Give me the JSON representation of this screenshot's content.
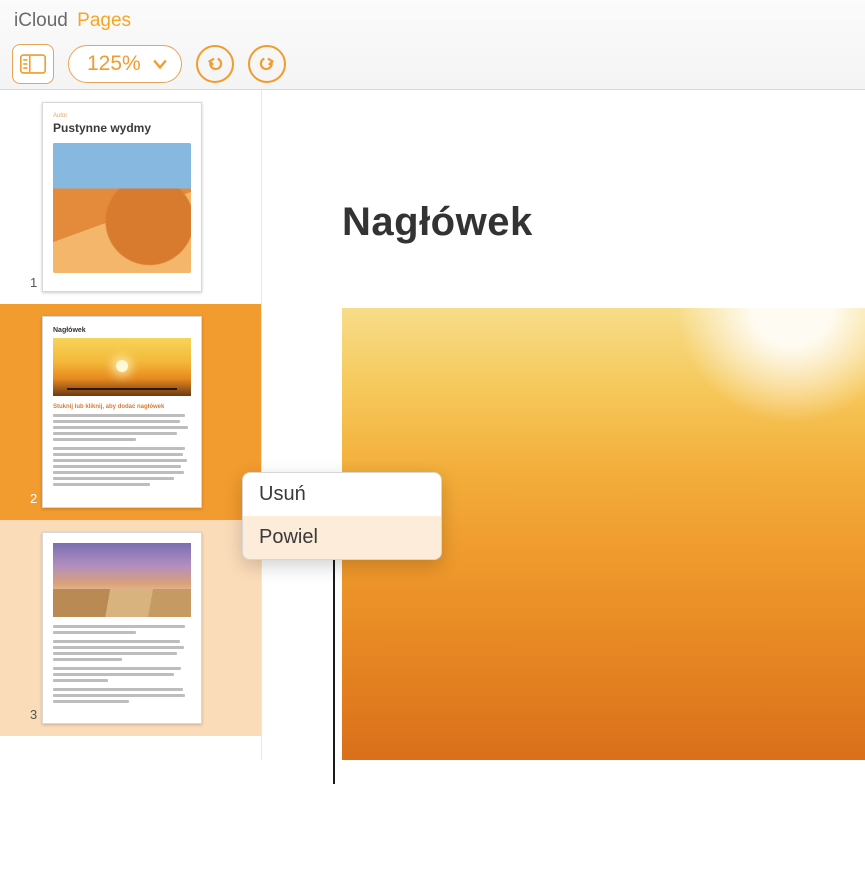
{
  "brand": {
    "cloud": "iCloud",
    "app": "Pages"
  },
  "toolbar": {
    "zoom_level": "125%",
    "view_button": "view-options",
    "undo": "undo",
    "redo": "redo"
  },
  "sidebar": {
    "thumbnails": [
      {
        "number": "1",
        "author_label": "Autor",
        "title": "Pustynne wydmy",
        "selected": false
      },
      {
        "number": "2",
        "heading": "Nagłówek",
        "subheading": "Stuknij lub kliknij, aby dodać nagłówek",
        "selected": true
      },
      {
        "number": "3",
        "selected": false
      }
    ]
  },
  "canvas": {
    "headline": "Nagłówek"
  },
  "context_menu": {
    "items": [
      {
        "label": "Usuń",
        "hover": false
      },
      {
        "label": "Powiel",
        "hover": true
      }
    ]
  }
}
